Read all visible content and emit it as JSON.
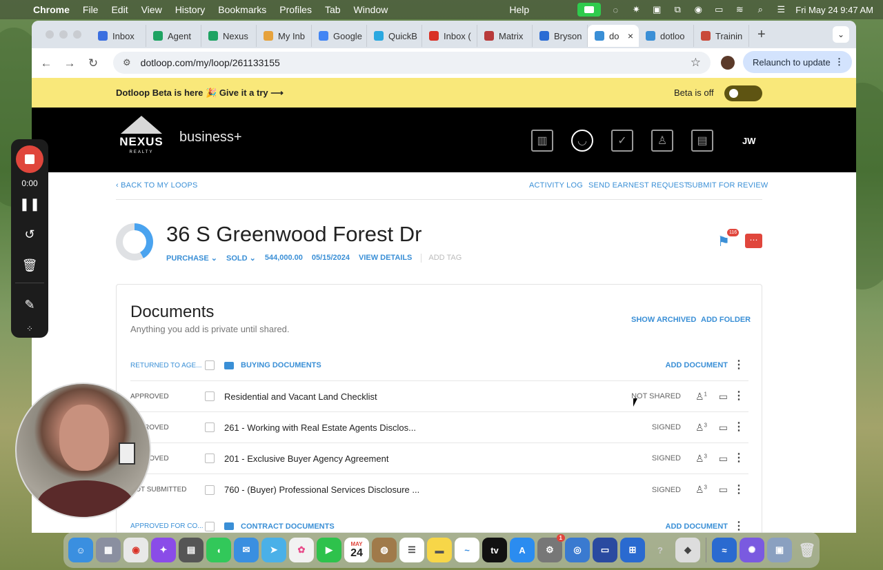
{
  "menubar": {
    "app": "Chrome",
    "items": [
      "File",
      "Edit",
      "View",
      "History",
      "Bookmarks",
      "Profiles",
      "Tab",
      "Window",
      "Help"
    ],
    "datetime": "Fri May 24  9:47 AM"
  },
  "tabs": [
    {
      "label": "Inbox",
      "color": "#3b6fe0"
    },
    {
      "label": "Agent",
      "color": "#1ea362"
    },
    {
      "label": "Nexus",
      "color": "#1ea362"
    },
    {
      "label": "My Inb",
      "color": "#e6a23c"
    },
    {
      "label": "Google",
      "color": "#4285f4"
    },
    {
      "label": "QuickB",
      "color": "#2aa8e0"
    },
    {
      "label": "Inbox (",
      "color": "#d93025"
    },
    {
      "label": "Matrix",
      "color": "#b83a3a"
    },
    {
      "label": "Bryson",
      "color": "#2b6cd4"
    },
    {
      "label": "do",
      "color": "#3a8fd6",
      "active": true
    },
    {
      "label": "dotloo",
      "color": "#3a8fd6"
    },
    {
      "label": "Trainin",
      "color": "#c94a3a"
    }
  ],
  "address": {
    "url": "dotloop.com/my/loop/261133155",
    "relaunch": "Relaunch to update"
  },
  "beta": {
    "message": "Dotloop Beta is here 🎉 Give it a try ⟶",
    "toggle_label": "Beta is off"
  },
  "header": {
    "brand": "NEXUS",
    "brand_sub": "REALTY",
    "plan": "business+",
    "user_initials": "JW"
  },
  "nav": {
    "back": "BACK TO MY LOOPS",
    "activity": "ACTIVITY LOG",
    "earnest": "SEND EARNEST REQUEST",
    "submit": "SUBMIT FOR REVIEW"
  },
  "loop": {
    "title": "36 S Greenwood Forest Dr",
    "type": "PURCHASE",
    "status": "SOLD",
    "price": "544,000.00",
    "date": "05/15/2024",
    "details": "VIEW DETAILS",
    "add_tag": "ADD TAG",
    "flag_count": "116",
    "progress": 0.42
  },
  "documents": {
    "title": "Documents",
    "subtitle": "Anything you add is private until shared.",
    "show_archived": "SHOW ARCHIVED",
    "add_folder": "ADD FOLDER",
    "add_document": "ADD DOCUMENT",
    "folders": [
      {
        "filter": "RETURNED TO AGE...",
        "name": "BUYING DOCUMENTS"
      },
      {
        "filter": "APPROVED FOR CO...",
        "name": "CONTRACT DOCUMENTS"
      }
    ],
    "rows": [
      {
        "state": "APPROVED",
        "name": "Residential and Vacant Land Checklist",
        "status": "NOT SHARED",
        "people": "1"
      },
      {
        "state": "APPROVED",
        "name": "261 - Working with Real Estate Agents Disclos...",
        "status": "SIGNED",
        "people": "3"
      },
      {
        "state": "APPROVED",
        "name": "201 - Exclusive Buyer Agency Agreement",
        "status": "SIGNED",
        "people": "3"
      },
      {
        "state": "NOT SUBMITTED",
        "name": "760 - (Buyer) Professional Services Disclosure ...",
        "status": "SIGNED",
        "people": "3"
      }
    ]
  },
  "recorder": {
    "time": "0:00"
  },
  "dock": {
    "calendar_month": "MAY",
    "calendar_day": "24",
    "appletv": "tv",
    "settings_badge": "1"
  }
}
